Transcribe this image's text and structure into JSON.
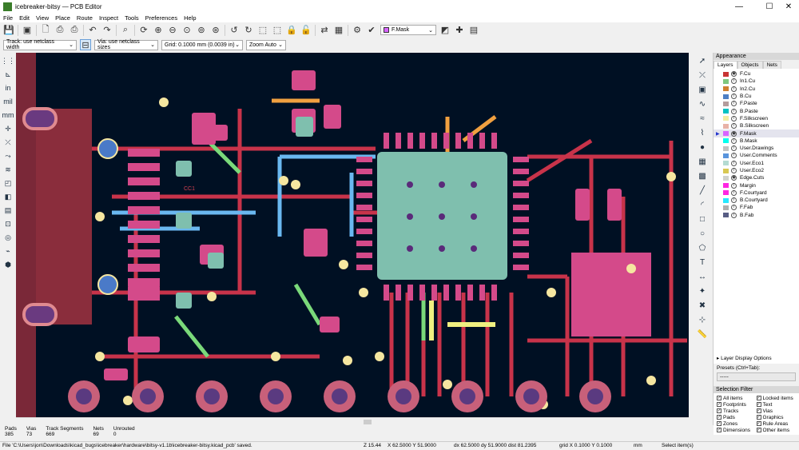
{
  "window": {
    "title": "icebreaker-bitsy — PCB Editor",
    "minimize": "—",
    "maximize": "☐",
    "close": "✕"
  },
  "menu": [
    "File",
    "Edit",
    "View",
    "Place",
    "Route",
    "Inspect",
    "Tools",
    "Preferences",
    "Help"
  ],
  "toolbar": {
    "layer_select": "F.Mask",
    "icons": [
      "save-icon",
      "board-setup-icon",
      "page-settings-icon",
      "print-icon",
      "plot-icon",
      "undo-icon",
      "redo-icon",
      "find-icon",
      "refresh-icon",
      "zoom-in-icon",
      "zoom-out-icon",
      "zoom-fit-icon",
      "zoom-objects-icon",
      "zoom-selection-icon",
      "rotate-ccw-icon",
      "rotate-cw-icon",
      "group-icon",
      "ungroup-icon",
      "lock-icon",
      "unlock-icon",
      "update-pcb-icon",
      "footprint-editor-icon",
      "netlist-icon",
      "drc-icon",
      "layer-pair-icon",
      "scripting-icon",
      "console-icon"
    ]
  },
  "toolbar2": {
    "track": "Track: use netclass width",
    "via": "Via: use netclass sizes",
    "grid": "Grid: 0.1000 mm (0.0039 in)",
    "zoom": "Zoom Auto"
  },
  "left_toolbar": [
    "grid-icon",
    "polar-icon",
    "inch-icon",
    "mil-icon",
    "mm-icon",
    "cursor-icon",
    "ratsnest-icon",
    "ratsnest-curved-icon",
    "outline-track-icon",
    "zone-display-icon",
    "contrast-icon",
    "layer-manager-icon",
    "pad-outline-icon",
    "via-outline-icon",
    "microwave-icon",
    "appearance-icon"
  ],
  "right_toolbar": [
    "select-icon",
    "local-ratsnest-icon",
    "footprint-icon",
    "route-track-icon",
    "diff-pair-icon",
    "tune-icon",
    "via-icon",
    "zone-icon",
    "rule-area-icon",
    "line-icon",
    "arc-icon",
    "rectangle-icon",
    "circle-icon",
    "polygon-icon",
    "text-icon",
    "dimension-icon",
    "anchor-icon",
    "delete-icon",
    "grid-origin-icon",
    "measure-icon"
  ],
  "canvas": {
    "silk_label": "CC1",
    "colors": {
      "background": "#001023",
      "front_copper": "#c8334a",
      "inner1": "#7ad97a",
      "inner2": "#f0a040",
      "back_copper": "#6ab8f0",
      "mask": "#d44a8a",
      "pad": "#7fbfae",
      "via_ring": "#f5e6a0"
    }
  },
  "appearance": {
    "title": "Appearance",
    "tabs": [
      "Layers",
      "Objects",
      "Nets"
    ],
    "layers": [
      {
        "name": "F.Cu",
        "color": "#c83434",
        "visible_icon": "eye"
      },
      {
        "name": "In1.Cu",
        "color": "#7fc87f",
        "visible_icon": "pencil"
      },
      {
        "name": "In2.Cu",
        "color": "#d08030",
        "visible_icon": "pencil"
      },
      {
        "name": "B.Cu",
        "color": "#4d7fc4",
        "visible_icon": "pencil"
      },
      {
        "name": "F.Paste",
        "color": "#b49c9c",
        "visible_icon": "pencil"
      },
      {
        "name": "B.Paste",
        "color": "#00c2c2",
        "visible_icon": "pencil"
      },
      {
        "name": "F.Silkscreen",
        "color": "#f2eda1",
        "visible_icon": "pencil"
      },
      {
        "name": "B.Silkscreen",
        "color": "#e8b2a7",
        "visible_icon": "pencil"
      },
      {
        "name": "F.Mask",
        "color": "#d864ff",
        "visible_icon": "eye",
        "selected": true
      },
      {
        "name": "B.Mask",
        "color": "#02ffee",
        "visible_icon": "pencil"
      },
      {
        "name": "User.Drawings",
        "color": "#c2c2c2",
        "visible_icon": "pencil"
      },
      {
        "name": "User.Comments",
        "color": "#5994dc",
        "visible_icon": "pencil"
      },
      {
        "name": "User.Eco1",
        "color": "#b4dbd2",
        "visible_icon": "pencil"
      },
      {
        "name": "User.Eco2",
        "color": "#d8c852",
        "visible_icon": "pencil"
      },
      {
        "name": "Edge.Cuts",
        "color": "#d0d2cd",
        "visible_icon": "eye"
      },
      {
        "name": "Margin",
        "color": "#ff26e2",
        "visible_icon": "pencil"
      },
      {
        "name": "F.Courtyard",
        "color": "#ff26e2",
        "visible_icon": "pencil"
      },
      {
        "name": "B.Courtyard",
        "color": "#26e9ff",
        "visible_icon": "pencil"
      },
      {
        "name": "F.Fab",
        "color": "#afafaf",
        "visible_icon": "pencil"
      },
      {
        "name": "B.Fab",
        "color": "#585d84",
        "visible_icon": "pencil"
      }
    ],
    "layer_display_options": "Layer Display Options",
    "presets_label": "Presets (Ctrl+Tab):",
    "presets_value": "-----",
    "selection_filter_title": "Selection Filter",
    "filters": [
      "All items",
      "Locked items",
      "Footprints",
      "Text",
      "Tracks",
      "Vias",
      "Pads",
      "Graphics",
      "Zones",
      "Rule Areas",
      "Dimensions",
      "Other items"
    ]
  },
  "stats": [
    {
      "label": "Pads",
      "value": "385"
    },
    {
      "label": "Vias",
      "value": "73"
    },
    {
      "label": "Track Segments",
      "value": "669"
    },
    {
      "label": "Nets",
      "value": "69"
    },
    {
      "label": "Unrouted",
      "value": "0"
    }
  ],
  "status": {
    "message": "File 'C:\\Users\\jon\\Downloads\\kicad_bugs\\icebreaker\\hardware\\bitsy-v1.1b\\icebreaker-bitsy.kicad_pcb' saved.",
    "z": "Z 15.44",
    "xy": "X 62.5000  Y 51.9000",
    "delta": "dx 62.5000  dy 51.9000  dist 81.2395",
    "grid": "grid X 0.1000  Y 0.1000",
    "units": "mm",
    "mode": "Select item(s)"
  }
}
